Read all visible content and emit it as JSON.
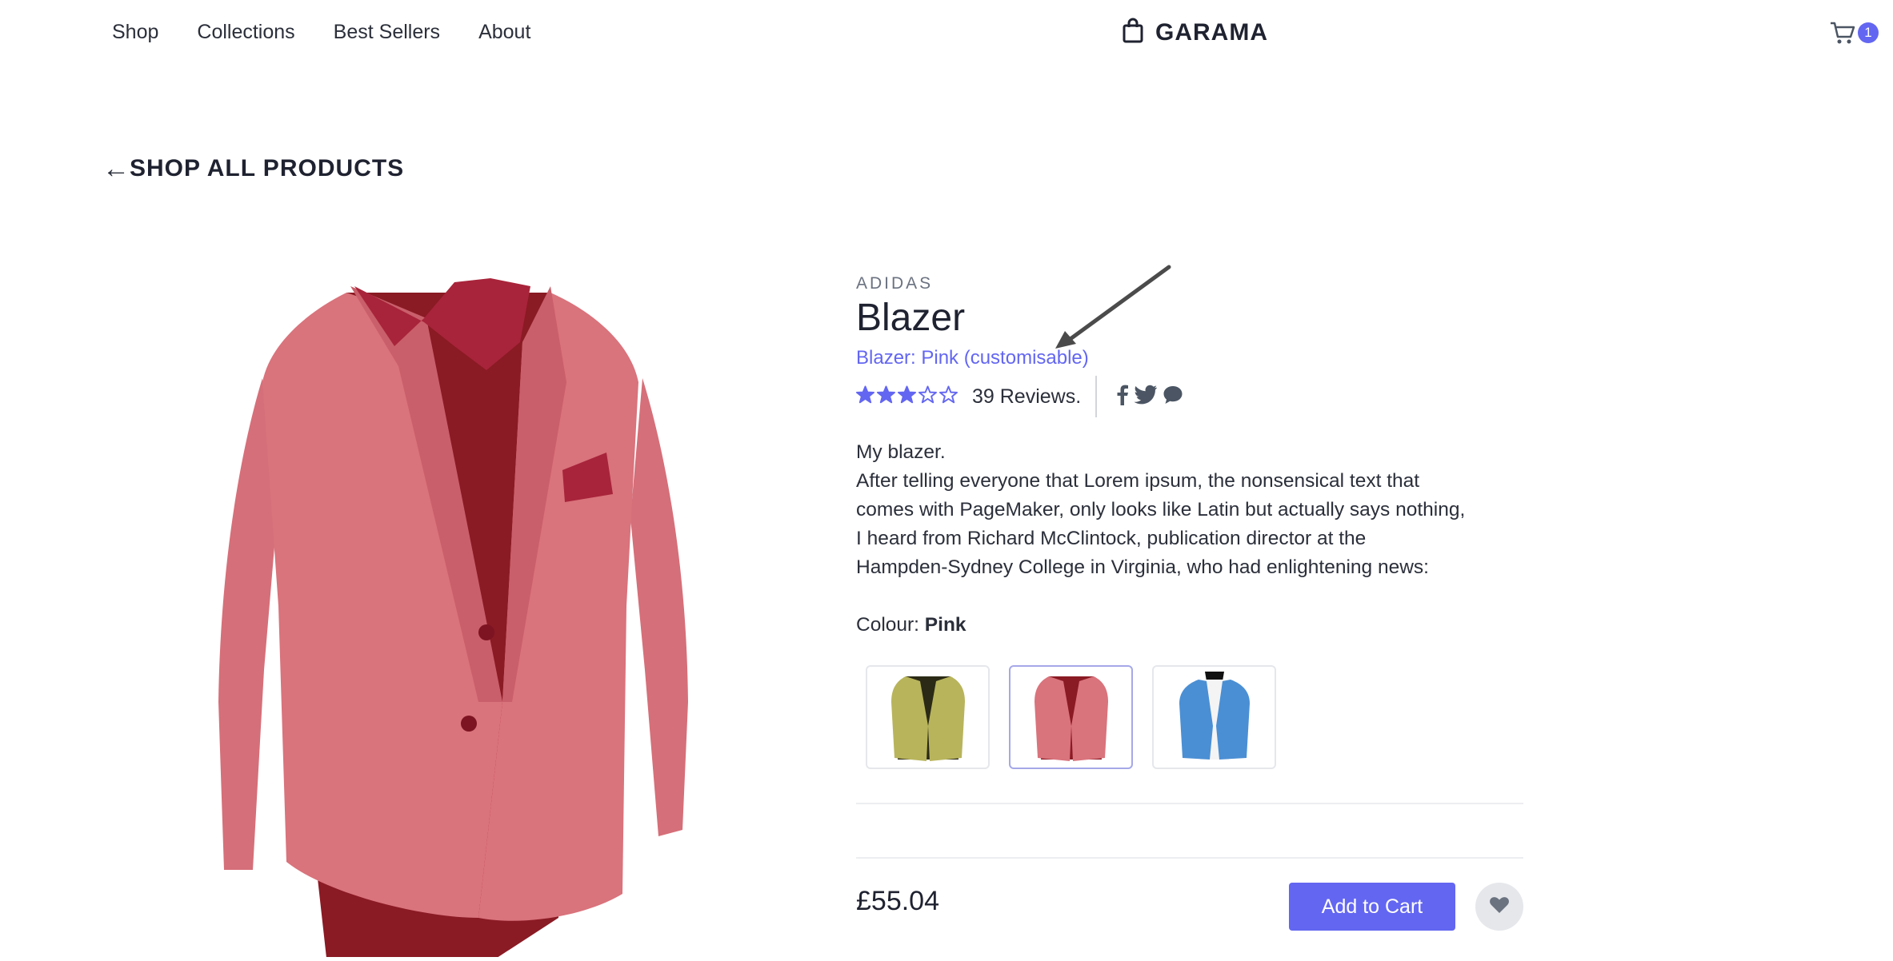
{
  "nav": {
    "links": [
      "Shop",
      "Collections",
      "Best Sellers",
      "About"
    ],
    "brand": "GARAMA",
    "cart_count": "1",
    "icons": {
      "brand": "shopping-bag-icon",
      "cart": "cart-icon"
    }
  },
  "back_link": {
    "arrow": "←",
    "label": "SHOP ALL PRODUCTS"
  },
  "product": {
    "brand": "ADIDAS",
    "title": "Blazer",
    "variant": "Blazer: Pink (customisable)",
    "rating": 3,
    "rating_max": 5,
    "reviews": "39 Reviews.",
    "description_lines": [
      "My blazer.",
      "After telling everyone that Lorem ipsum, the nonsensical text that",
      "comes with PageMaker, only looks like Latin but actually says nothing,",
      "I heard from Richard McClintock, publication director at the",
      "Hampden-Sydney College in Virginia, who had enlightening news:"
    ],
    "colour_label": "Colour: ",
    "colour_value": "Pink",
    "swatches": [
      {
        "colour": "olive",
        "fill": "#b8b45c",
        "selected": false
      },
      {
        "colour": "pink",
        "fill": "#d9737c",
        "selected": true
      },
      {
        "colour": "blue",
        "fill": "#4a8fd4",
        "selected": false
      }
    ],
    "price": "£55.04",
    "add_to_cart": "Add to Cart"
  },
  "colors": {
    "accent": "#6366f1",
    "text": "#1f2230",
    "muted": "#6b7280",
    "blazer_pink": "#d9737c",
    "lining": "#8a1a24"
  }
}
